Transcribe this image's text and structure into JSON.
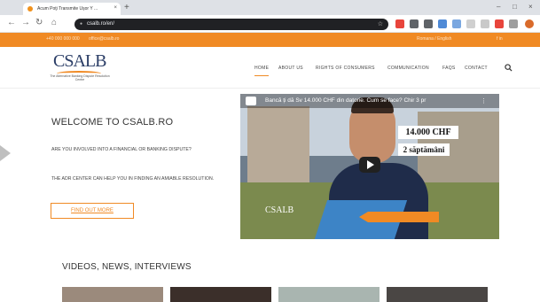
{
  "browser": {
    "tab_title": "Acum Poţi Transmite Ușor Y ...",
    "omnibox_url": "csalb.ro/en/",
    "new_tab_label": "+",
    "window_controls": [
      "–",
      "□",
      "×"
    ]
  },
  "topbar": {
    "left_items": [
      "+40 000 000 000",
      "office@csalb.ro"
    ],
    "right_items": [
      "Romana / English",
      "f  in"
    ]
  },
  "header": {
    "logo_text": "CSALB",
    "logo_subtitle": "The Alternative Banking Dispute Resolution Centre",
    "nav": [
      "HOME",
      "ABOUT US",
      "RIGHTS OF CONSUMERS",
      "COMMUNICATION",
      "FAQS",
      "CONTACT"
    ],
    "search_icon": "search-icon"
  },
  "hero": {
    "title": "WELCOME TO CSALB.RO",
    "paragraph1": "ARE YOU INVOLVED INTO A FINANCIAL OR BANKING DISPUTE?",
    "paragraph2": "THE ADR CENTER CAN HELP YOU IN FINDING AN AMIABLE RESOLUTION.",
    "button_label": "FIND OUT MORE"
  },
  "video": {
    "title": "Bancă ți dă Sv 14.000 CHF din datorie. Cum se face? Chir 3 pr",
    "overlay_label_1": "14.000 CHF",
    "overlay_label_2": "2 săptămâni",
    "logo_text": "CSALB"
  },
  "section": {
    "title": "VIDEOS, NEWS, INTERVIEWS"
  },
  "colors": {
    "accent": "#f08a24",
    "brand_navy": "#2a3d66",
    "video_blue": "#3d84c6"
  }
}
